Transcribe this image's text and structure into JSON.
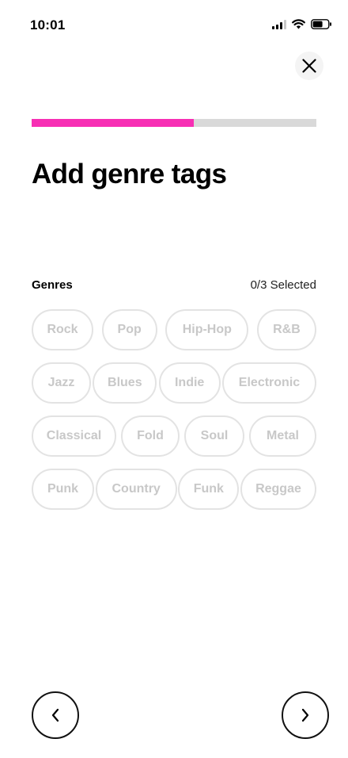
{
  "status_bar": {
    "time": "10:01",
    "signal_icon": "cellular-signal-icon",
    "wifi_icon": "wifi-icon",
    "battery_icon": "battery-icon"
  },
  "close_icon": "close-icon",
  "progress": {
    "fraction": 0.57,
    "fill_color": "#f72fb4",
    "track_color": "#d9d9d9"
  },
  "title": "Add genre tags",
  "genres": {
    "label": "Genres",
    "selected_count": "0/3 Selected",
    "rows": [
      {
        "chips": [
          "Rock",
          "Pop",
          "Hip-Hop",
          "R&B"
        ]
      },
      {
        "chips": [
          "Jazz",
          "Blues",
          "Indie",
          "Electronic"
        ]
      },
      {
        "chips": [
          "Classical",
          "Fold",
          "Soul",
          "Metal"
        ]
      },
      {
        "chips": [
          "Punk",
          "Country",
          "Funk",
          "Reggae"
        ]
      }
    ]
  },
  "navigation": {
    "back_icon": "chevron-left-icon",
    "next_icon": "chevron-right-icon"
  }
}
